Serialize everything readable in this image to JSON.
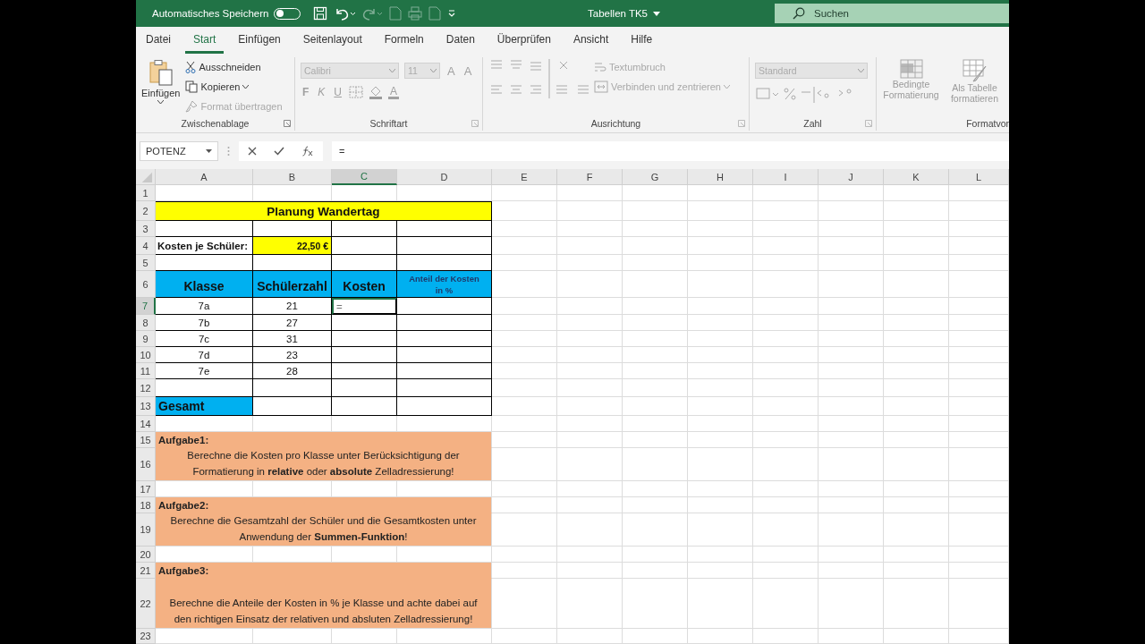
{
  "title_bar": {
    "autosave_label": "Automatisches Speichern",
    "autosave_on": false,
    "document_title": "Tabellen TK5",
    "search": {
      "placeholder": "Suchen"
    }
  },
  "menu_tabs": [
    {
      "label": "Datei",
      "selected": false
    },
    {
      "label": "Start",
      "selected": true
    },
    {
      "label": "Einfügen",
      "selected": false
    },
    {
      "label": "Seitenlayout",
      "selected": false
    },
    {
      "label": "Formeln",
      "selected": false
    },
    {
      "label": "Daten",
      "selected": false
    },
    {
      "label": "Überprüfen",
      "selected": false
    },
    {
      "label": "Ansicht",
      "selected": false
    },
    {
      "label": "Hilfe",
      "selected": false
    }
  ],
  "ribbon": {
    "clipboard": {
      "label": "Zwischenablage",
      "paste": "Einfügen",
      "items": [
        {
          "kind": "cut",
          "label": "Ausschneiden",
          "disabled": false
        },
        {
          "kind": "copy",
          "label": "Kopieren",
          "disabled": false
        },
        {
          "kind": "brush",
          "label": "Format übertragen",
          "disabled": true
        }
      ]
    },
    "font": {
      "label": "Schriftart",
      "font_name": "Calibri",
      "font_size": "11",
      "grow": "A",
      "shrink": "A",
      "bold": "F",
      "italic": "K",
      "underline": "U",
      "text_color_label": "A",
      "disabled": true
    },
    "alignment": {
      "label": "Ausrichtung",
      "wrap": "Textumbruch",
      "merge": "Verbinden und zentrieren",
      "disabled": true
    },
    "number": {
      "label": "Zahl",
      "format": "Standard",
      "disabled": true
    },
    "styles": {
      "label": "Formatvor",
      "items": [
        {
          "kind": "conditional",
          "lines": [
            "Bedingte",
            "Formatierung"
          ]
        },
        {
          "kind": "table",
          "lines": [
            "Als Tabelle",
            "formatieren"
          ]
        }
      ],
      "disabled": true
    }
  },
  "formula_bar": {
    "name_box": "POTENZ",
    "formula": "="
  },
  "sheet": {
    "columns": [
      {
        "label": "A",
        "selected": false
      },
      {
        "label": "B",
        "selected": false
      },
      {
        "label": "C",
        "selected": true
      },
      {
        "label": "D",
        "selected": false
      },
      {
        "label": "E",
        "selected": false
      },
      {
        "label": "F",
        "selected": false
      },
      {
        "label": "G",
        "selected": false
      },
      {
        "label": "H",
        "selected": false
      },
      {
        "label": "I",
        "selected": false
      },
      {
        "label": "J",
        "selected": false
      },
      {
        "label": "K",
        "selected": false
      },
      {
        "label": "L",
        "selected": false
      }
    ],
    "rows": [
      {
        "label": "1",
        "selected": false,
        "framed": false
      },
      {
        "label": "2",
        "selected": false,
        "framed": true,
        "cells": [
          {
            "kind": "title",
            "text": "Planung Wandertag"
          }
        ]
      },
      {
        "label": "3",
        "selected": false,
        "framed": true
      },
      {
        "label": "4",
        "selected": false,
        "framed": true,
        "cells": [
          {
            "kind": "label",
            "text": "Kosten je Schüler:"
          },
          {
            "kind": "money",
            "text": "22,50 €"
          }
        ]
      },
      {
        "label": "5",
        "selected": false,
        "framed": true
      },
      {
        "label": "6",
        "selected": false,
        "framed": true,
        "cells": [
          {
            "kind": "header",
            "text": "Klasse"
          },
          {
            "kind": "header",
            "text": "Schülerzahl"
          },
          {
            "kind": "header",
            "text": "Kosten"
          },
          {
            "kind": "header_small",
            "text": "Anteil der Kosten in %"
          }
        ]
      },
      {
        "label": "7",
        "selected": true,
        "framed": true,
        "cells": [
          {
            "kind": "center",
            "text": "7a"
          },
          {
            "kind": "center",
            "text": "21"
          },
          {
            "kind": "active",
            "text": "="
          }
        ]
      },
      {
        "label": "8",
        "selected": false,
        "framed": true,
        "cells": [
          {
            "kind": "center",
            "text": "7b"
          },
          {
            "kind": "center",
            "text": "27"
          }
        ]
      },
      {
        "label": "9",
        "selected": false,
        "framed": true,
        "cells": [
          {
            "kind": "center",
            "text": "7c"
          },
          {
            "kind": "center",
            "text": "31"
          }
        ]
      },
      {
        "label": "10",
        "selected": false,
        "framed": true,
        "cells": [
          {
            "kind": "center",
            "text": "7d"
          },
          {
            "kind": "center",
            "text": "23"
          }
        ]
      },
      {
        "label": "11",
        "selected": false,
        "framed": true,
        "cells": [
          {
            "kind": "center",
            "text": "7e"
          },
          {
            "kind": "center",
            "text": "28"
          }
        ]
      },
      {
        "label": "12",
        "selected": false,
        "framed": true
      },
      {
        "label": "13",
        "selected": false,
        "framed": true,
        "cells": [
          {
            "kind": "total",
            "text": "Gesamt"
          }
        ]
      },
      {
        "label": "14",
        "selected": false,
        "framed": false
      },
      {
        "label": "15",
        "selected": false,
        "framed": false,
        "cells": [
          {
            "kind": "task_heading",
            "text": "Aufgabe1:"
          }
        ]
      },
      {
        "label": "16",
        "selected": false,
        "framed": false,
        "cells": [
          {
            "kind": "task_text",
            "text": "Berechne die Kosten pro Klasse unter Berücksichtigung der Formatierung in **relative** oder **absolute** Zelladressierung!"
          }
        ]
      },
      {
        "label": "17",
        "selected": false,
        "framed": false
      },
      {
        "label": "18",
        "selected": false,
        "framed": false,
        "cells": [
          {
            "kind": "task_heading",
            "text": "Aufgabe2:"
          }
        ]
      },
      {
        "label": "19",
        "selected": false,
        "framed": false,
        "cells": [
          {
            "kind": "task_text",
            "text": "Berechne die Gesamtzahl der Schüler und die Gesamtkosten unter Anwendung der **Summen-Funktion**!"
          }
        ]
      },
      {
        "label": "20",
        "selected": false,
        "framed": false
      },
      {
        "label": "21",
        "selected": false,
        "framed": false,
        "cells": [
          {
            "kind": "task_heading",
            "text": "Aufgabe3:"
          }
        ]
      },
      {
        "label": "22",
        "selected": false,
        "framed": false,
        "cells": [
          {
            "kind": "task_text",
            "text": "Berechne die Anteile der Kosten in % je Klasse und achte dabei auf den richtigen Einsatz der relativen und absluten Zelladressierung!"
          }
        ]
      },
      {
        "label": "23",
        "selected": false,
        "framed": false
      }
    ]
  }
}
